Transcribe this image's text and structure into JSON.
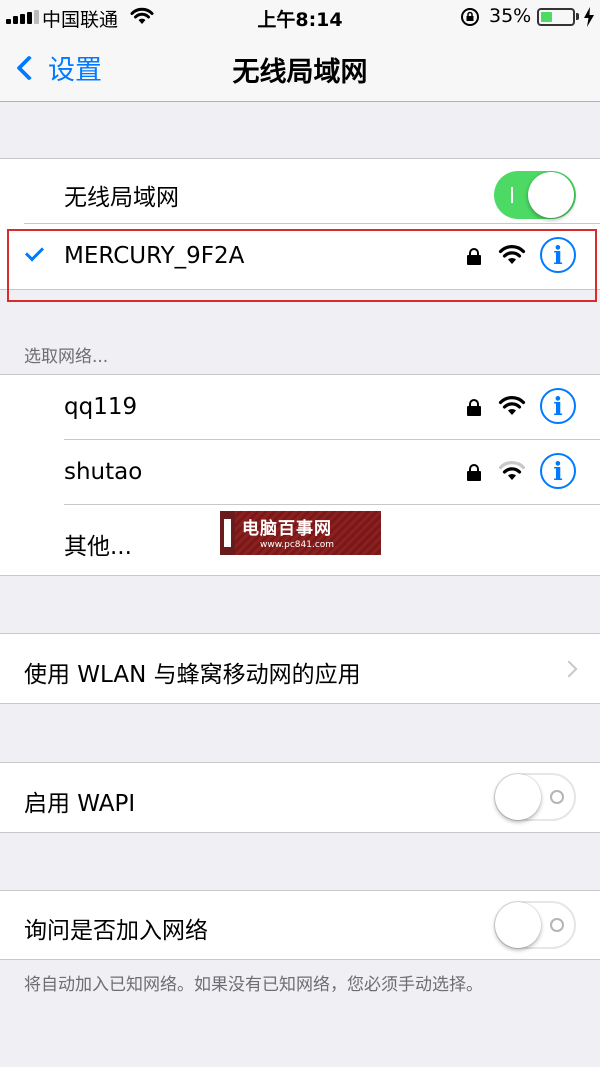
{
  "status_bar": {
    "carrier": "中国联通",
    "time": "上午8:14",
    "battery_percent": "35%",
    "battery_level": 0.35
  },
  "nav": {
    "back_label": "设置",
    "title": "无线局域网"
  },
  "wifi_section": {
    "toggle_label": "无线局域网",
    "toggle_on": true,
    "connected_network": "MERCURY_9F2A"
  },
  "networks_header": "选取网络...",
  "networks": [
    {
      "name": "qq119",
      "secured": true,
      "signal": 3
    },
    {
      "name": "shutao",
      "secured": true,
      "signal": 2
    }
  ],
  "other_label": "其他...",
  "wlan_apps_label": "使用 WLAN 与蜂窝移动网的应用",
  "wapi": {
    "label": "启用 WAPI",
    "on": false
  },
  "ask_join": {
    "label": "询问是否加入网络",
    "on": false
  },
  "footer": "将自动加入已知网络。如果没有已知网络，您必须手动选择。",
  "watermark": {
    "title": "电脑百事网",
    "url": "www.pc841.com"
  },
  "colors": {
    "accent": "#007aff",
    "toggle_on": "#4cd964",
    "highlight": "#d92b2b"
  },
  "icons": [
    "signal-icon",
    "wifi-icon",
    "orientation-lock-icon",
    "battery-icon",
    "charging-bolt-icon",
    "back-chevron-icon",
    "checkmark-icon",
    "lock-icon",
    "info-icon",
    "disclosure-chevron-icon"
  ]
}
